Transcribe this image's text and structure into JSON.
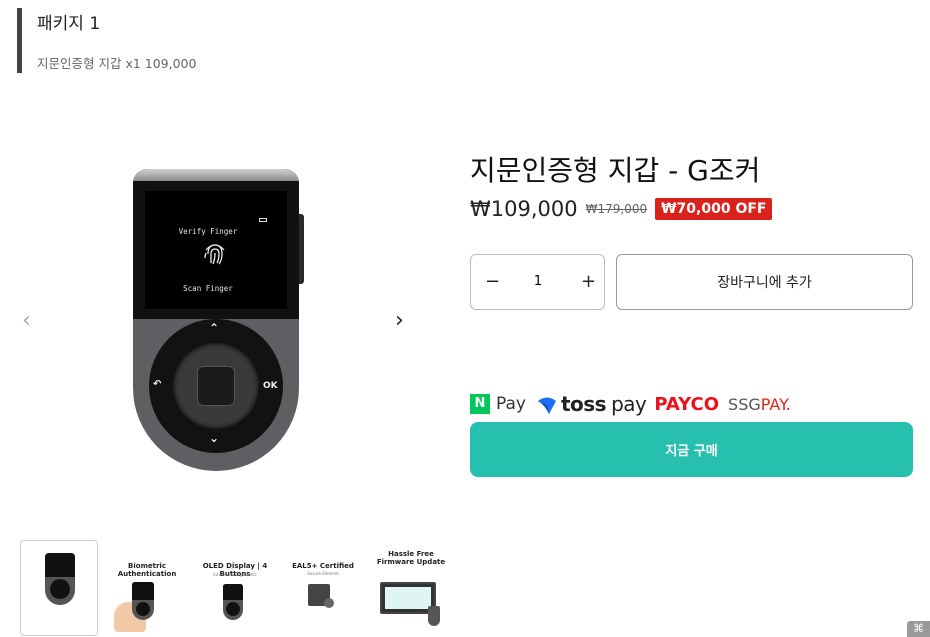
{
  "package": {
    "title": "패키지 1",
    "subtitle": "지문인증형 지갑 x1 109,000"
  },
  "gallery": {
    "prev_icon": "‹",
    "next_icon": "›",
    "device_screen": {
      "line1": "Verify Finger",
      "line2": "Scan Finger"
    },
    "device_labels": {
      "up": "⌃",
      "down": "⌄",
      "back": "↶",
      "ok": "OK"
    }
  },
  "product": {
    "title": "지문인증형 지갑 - G조커",
    "price": "₩109,000",
    "compare_price": "₩179,000",
    "discount_badge": "₩70,000 OFF",
    "quantity": {
      "minus": "−",
      "value": "1",
      "plus": "+"
    },
    "add_to_cart": "장바구니에 추가",
    "buy_now": "지금 구매"
  },
  "payments": {
    "npay": {
      "icon": "N",
      "label": "Pay"
    },
    "toss": {
      "brand": "toss",
      "label": "pay"
    },
    "payco": "PAYCO",
    "ssg": {
      "prefix": "SSG",
      "suffix": "PAY."
    }
  },
  "thumbnails": [
    {
      "caption": "",
      "sub": ""
    },
    {
      "caption": "Biometric Authentication",
      "sub": ""
    },
    {
      "caption": "OLED Display | 4 Buttons",
      "sub": "Intuitive & Ergonomic"
    },
    {
      "caption": "EAL5+ Certified",
      "sub": "Secure Element"
    },
    {
      "caption": "Hassle Free Firmware Update",
      "sub": ""
    }
  ],
  "colors": {
    "accent": "#27bfae",
    "badge": "#d9221c",
    "npay": "#03c75a",
    "toss": "#1a6ff0",
    "payco": "#e8111c"
  }
}
